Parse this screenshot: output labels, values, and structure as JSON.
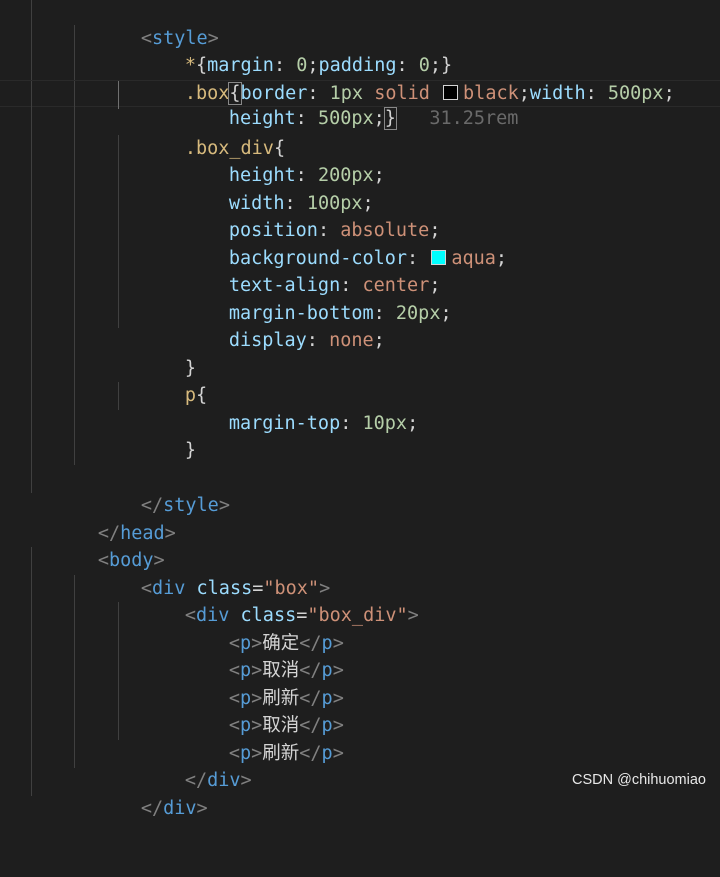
{
  "editor": {
    "colors": {
      "background": "#1e1e1e",
      "tag": "#569cd6",
      "attribute": "#9cdcfe",
      "string": "#ce9178",
      "selector": "#d7ba7d",
      "number": "#b5cea8"
    },
    "lines": {
      "l1": {
        "open": "<",
        "tag": "style",
        "close": ">"
      },
      "l2": {
        "sel": "*",
        "brace_open": "{",
        "prop1": "margin",
        "colon1": ": ",
        "val1": "0",
        "semi1": ";",
        "prop2": "padding",
        "colon2": ": ",
        "val2": "0",
        "semi2": ";",
        "brace_close": "}"
      },
      "l3": {
        "sel": ".box",
        "brace_open": "{",
        "prop1": "border",
        "colon1": ": ",
        "num1": "1px",
        "val1": "solid",
        "swatch_color": "#000000",
        "color_val": "black",
        "semi1": ";",
        "prop2": "width",
        "colon2": ": ",
        "num2": "500px",
        "semi2": ";"
      },
      "l4": {
        "prop": "height",
        "colon": ": ",
        "num": "500px",
        "semi": ";",
        "brace_close": "}",
        "hint": "31.25rem"
      },
      "l5": {
        "sel": ".box_div",
        "brace_open": "{"
      },
      "l6": {
        "prop": "height",
        "colon": ": ",
        "num": "200px",
        "semi": ";"
      },
      "l7": {
        "prop": "width",
        "colon": ": ",
        "num": "100px",
        "semi": ";"
      },
      "l8": {
        "prop": "position",
        "colon": ": ",
        "val": "absolute",
        "semi": ";"
      },
      "l9": {
        "prop": "background-color",
        "colon": ": ",
        "swatch_color": "#00ffff",
        "val": "aqua",
        "semi": ";"
      },
      "l10": {
        "prop": "text-align",
        "colon": ": ",
        "val": "center",
        "semi": ";"
      },
      "l11": {
        "prop": "margin-bottom",
        "colon": ": ",
        "num": "20px",
        "semi": ";"
      },
      "l12": {
        "prop": "display",
        "colon": ": ",
        "val": "none",
        "semi": ";"
      },
      "l13": {
        "brace_close": "}"
      },
      "l14": {
        "sel": "p",
        "brace_open": "{"
      },
      "l15": {
        "prop": "margin-top",
        "colon": ": ",
        "num": "10px",
        "semi": ";"
      },
      "l16": {
        "brace_close": "}"
      },
      "l18": {
        "open": "</",
        "tag": "style",
        "close": ">"
      },
      "l19": {
        "open": "</",
        "tag": "head",
        "close": ">"
      },
      "l20": {
        "open": "<",
        "tag": "body",
        "close": ">"
      },
      "l21": {
        "open": "<",
        "tag": "div",
        "attr": "class",
        "eq": "=",
        "str": "\"box\"",
        "close": ">"
      },
      "l22": {
        "open": "<",
        "tag": "div",
        "attr": "class",
        "eq": "=",
        "str": "\"box_div\"",
        "close": ">"
      },
      "l23": {
        "o1": "<",
        "t1": "p",
        "c1": ">",
        "text": "确定",
        "o2": "</",
        "t2": "p",
        "c2": ">"
      },
      "l24": {
        "o1": "<",
        "t1": "p",
        "c1": ">",
        "text": "取消",
        "o2": "</",
        "t2": "p",
        "c2": ">"
      },
      "l25": {
        "o1": "<",
        "t1": "p",
        "c1": ">",
        "text": "刷新",
        "o2": "</",
        "t2": "p",
        "c2": ">"
      },
      "l26": {
        "o1": "<",
        "t1": "p",
        "c1": ">",
        "text": "取消",
        "o2": "</",
        "t2": "p",
        "c2": ">"
      },
      "l27": {
        "o1": "<",
        "t1": "p",
        "c1": ">",
        "text": "刷新",
        "o2": "</",
        "t2": "p",
        "c2": ">"
      },
      "l28": {
        "open": "</",
        "tag": "div",
        "close": ">"
      },
      "l29": {
        "open": "</",
        "tag": "div",
        "close": ">"
      }
    }
  },
  "watermark": "CSDN @chihuomiao"
}
